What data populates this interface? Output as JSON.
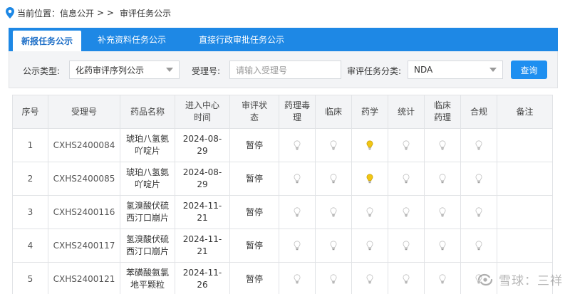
{
  "breadcrumb": {
    "prefix": "当前位置：",
    "section": "信息公开",
    "separator": "> >",
    "current": "审评任务公示"
  },
  "tabs": [
    {
      "label": "新报任务公示",
      "active": true
    },
    {
      "label": "补充资料任务公示",
      "active": false
    },
    {
      "label": "直接行政审批任务公示",
      "active": false
    }
  ],
  "filters": {
    "type_label": "公示类型:",
    "type_value": "化药审评序列公示",
    "accept_label": "受理号:",
    "accept_placeholder": "请输入受理号",
    "category_label": "审评任务分类:",
    "category_value": "NDA",
    "query_button": "查询"
  },
  "table": {
    "headers": [
      "序号",
      "受理号",
      "药品名称",
      "进入中心\n时间",
      "审评状\n态",
      "药理毒\n理",
      "临床",
      "药学",
      "统计",
      "临床\n药理",
      "合规",
      "备注"
    ],
    "rows": [
      {
        "no": "1",
        "code": "CXHS2400084",
        "name": "琥珀八氢氨\n吖啶片",
        "date": "2024-08-\n29",
        "status": "暂停",
        "lit": [
          false,
          false,
          true,
          false,
          false,
          false
        ]
      },
      {
        "no": "2",
        "code": "CXHS2400085",
        "name": "琥珀八氢氨\n吖啶片",
        "date": "2024-08-\n29",
        "status": "暂停",
        "lit": [
          false,
          false,
          true,
          false,
          false,
          false
        ]
      },
      {
        "no": "3",
        "code": "CXHS2400116",
        "name": "氢溴酸伏硫\n西汀口崩片",
        "date": "2024-11-\n21",
        "status": "暂停",
        "lit": [
          false,
          false,
          false,
          false,
          false,
          false
        ]
      },
      {
        "no": "4",
        "code": "CXHS2400117",
        "name": "氢溴酸伏硫\n西汀口崩片",
        "date": "2024-11-\n21",
        "status": "暂停",
        "lit": [
          false,
          false,
          false,
          false,
          false,
          false
        ]
      },
      {
        "no": "5",
        "code": "CXHS2400121",
        "name": "苯磺酸氨氯\n地平颗粒",
        "date": "2024-11-\n26",
        "status": "暂停",
        "lit": [
          false,
          false,
          false,
          false,
          false,
          false
        ]
      }
    ]
  },
  "colors": {
    "accent": "#1e88e5",
    "bulb_off": "#d0d0d0",
    "bulb_on": "#f2c614"
  },
  "watermark": {
    "text": "雪球：三祥"
  }
}
